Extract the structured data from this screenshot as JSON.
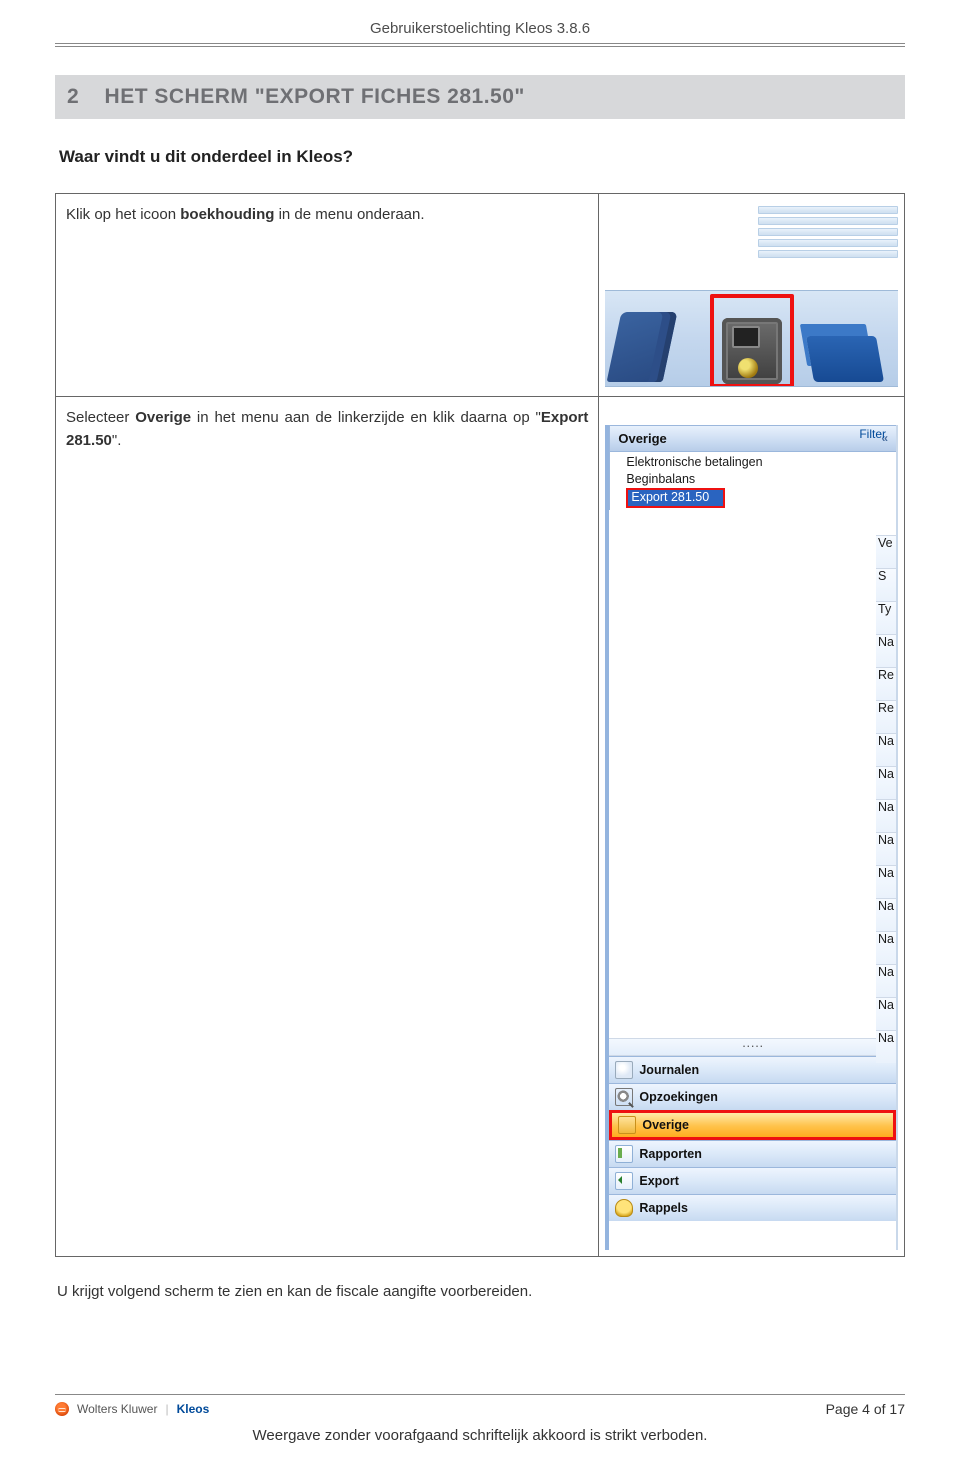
{
  "header": {
    "doc_title": "Gebruikerstoelichting Kleos 3.8.6"
  },
  "section": {
    "number": "2",
    "title": "HET SCHERM \"EXPORT FICHES 281.50\"",
    "intro": "Waar vindt u dit onderdeel in Kleos?"
  },
  "steps": [
    {
      "text_parts": [
        "Klik op het icoon ",
        "boekhouding",
        " in de menu onderaan."
      ],
      "bold_index": 1
    },
    {
      "text_parts": [
        "Selecteer ",
        "Overige",
        " in het menu aan de linkerzijde en klik daarna op \"",
        "Export 281.50",
        "\"."
      ],
      "bold_indices": [
        1,
        3
      ]
    }
  ],
  "panel": {
    "filter_label": "Filter",
    "heading": "Overige",
    "sub_items": [
      "Elektronische betalingen",
      "Beginbalans",
      "Export 281.50"
    ],
    "right_markers": [
      "Ve",
      "S",
      "Ty",
      "Na",
      "Re",
      "Re",
      "Na",
      "Na",
      "Na",
      "Na",
      "Na",
      "Na",
      "Na",
      "Na",
      "Na",
      "Na"
    ],
    "nav": [
      {
        "label": "Journalen",
        "icon": "journ",
        "selected": false
      },
      {
        "label": "Opzoekingen",
        "icon": "search",
        "selected": false
      },
      {
        "label": "Overige",
        "icon": "folder",
        "selected": true
      },
      {
        "label": "Rapporten",
        "icon": "report",
        "selected": false
      },
      {
        "label": "Export",
        "icon": "export",
        "selected": false
      },
      {
        "label": "Rappels",
        "icon": "bell",
        "selected": false
      }
    ]
  },
  "after_steps": "U krijgt volgend scherm te zien en kan de fiscale aangifte voorbereiden.",
  "footer": {
    "brand1": "Wolters Kluwer",
    "brand2": "Kleos",
    "page_label": "Page 4 of 17",
    "disclaimer": "Weergave zonder voorafgaand schriftelijk akkoord is strikt verboden."
  }
}
